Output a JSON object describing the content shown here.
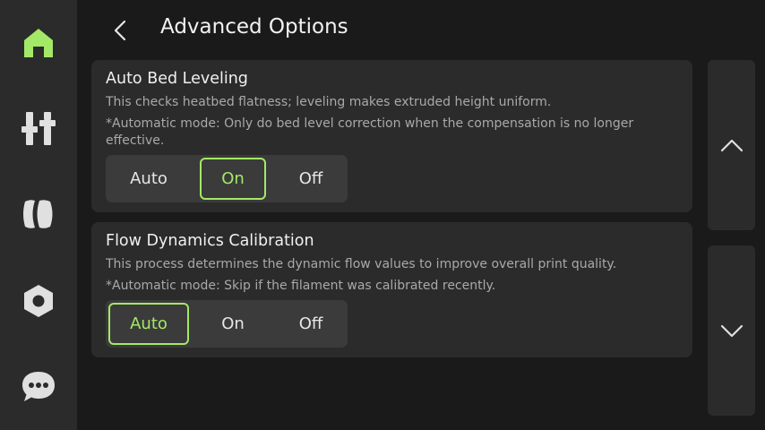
{
  "colors": {
    "accent": "#a4e867",
    "sidebar_bg": "#2b2b2b",
    "page_bg": "#1a1a1a",
    "card_bg": "#2b2b2b",
    "segment_bg": "#3b3b3b",
    "icon_gray": "#e0e0e0"
  },
  "sidebar": {
    "items": [
      {
        "icon": "home-icon",
        "active": true
      },
      {
        "icon": "sliders-icon",
        "active": false
      },
      {
        "icon": "filament-spool-icon",
        "active": false
      },
      {
        "icon": "settings-nut-icon",
        "active": false
      },
      {
        "icon": "chat-bubble-icon",
        "active": false
      }
    ]
  },
  "header": {
    "back_icon": "chevron-left-icon",
    "title": "Advanced Options"
  },
  "options": [
    {
      "title": "Auto Bed Leveling",
      "desc_1": "This checks heatbed flatness; leveling makes extruded height uniform.",
      "desc_2": "*Automatic mode: Only do bed level correction when the compensation is no longer effective.",
      "choices": [
        "Auto",
        "On",
        "Off"
      ],
      "selected": "On"
    },
    {
      "title": "Flow Dynamics Calibration",
      "desc_1": "This process determines the dynamic flow values to improve overall print quality.",
      "desc_2": "*Automatic mode: Skip if the filament was calibrated recently.",
      "choices": [
        "Auto",
        "On",
        "Off"
      ],
      "selected": "Auto"
    }
  ],
  "scroll": {
    "up_icon": "chevron-up-icon",
    "down_icon": "chevron-down-icon"
  }
}
